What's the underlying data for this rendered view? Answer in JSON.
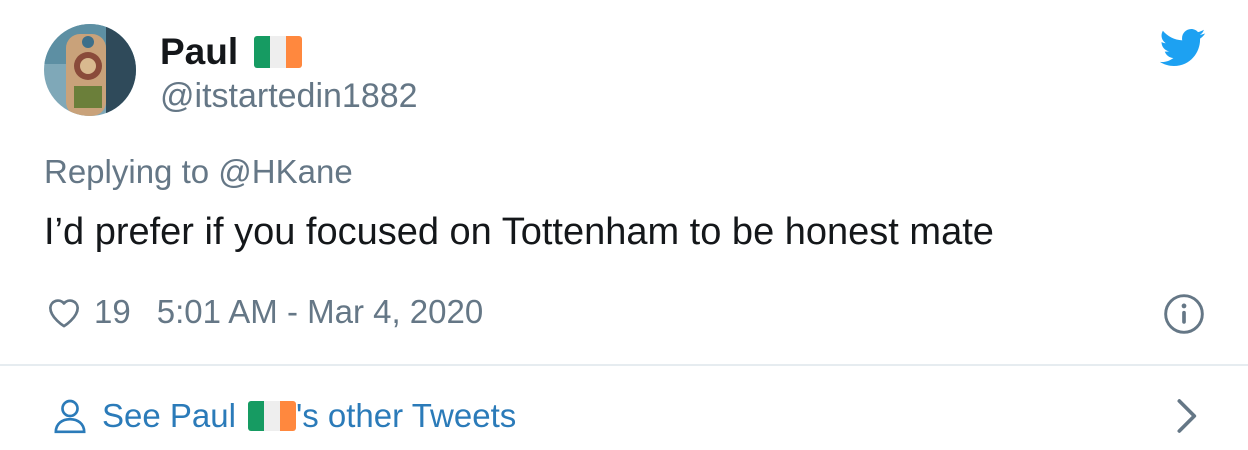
{
  "author": {
    "display_name": "Paul",
    "handle": "@itstartedin1882",
    "flag_icon": "ireland-flag-emoji"
  },
  "reply": {
    "prefix": "Replying to ",
    "target": "@HKane"
  },
  "tweet": {
    "text": "I’d prefer if you focused on Tottenham to be honest mate"
  },
  "meta": {
    "like_count": "19",
    "timestamp": "5:01 AM - Mar 4, 2020"
  },
  "footer": {
    "see_prefix": "See Paul",
    "see_suffix": "'s other Tweets"
  },
  "icons": {
    "brand": "twitter-bird-icon",
    "like": "heart-icon",
    "info": "info-icon",
    "profile": "person-icon",
    "nav": "chevron-right-icon"
  },
  "colors": {
    "twitter_blue": "#1da1f2",
    "link_blue": "#2b7bb9",
    "secondary_gray": "#657786",
    "text_dark": "#14171a"
  }
}
